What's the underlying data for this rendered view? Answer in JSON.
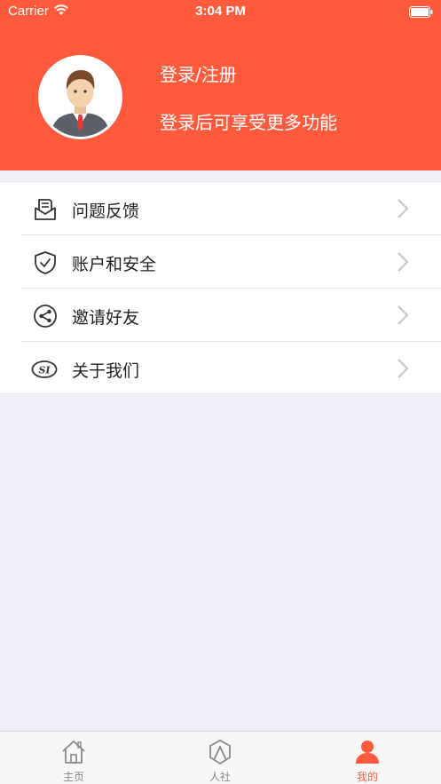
{
  "status_bar": {
    "carrier": "Carrier",
    "time": "3:04 PM"
  },
  "profile": {
    "title": "登录/注册",
    "subtitle": "登录后可享受更多功能"
  },
  "menu": {
    "items": [
      {
        "label": "问题反馈",
        "icon": "feedback-envelope-icon"
      },
      {
        "label": "账户和安全",
        "icon": "shield-check-icon"
      },
      {
        "label": "邀请好友",
        "icon": "share-icon"
      },
      {
        "label": "关于我们",
        "icon": "si-logo-icon"
      }
    ]
  },
  "tabbar": {
    "tabs": [
      {
        "label": "主页",
        "icon": "home-icon",
        "active": false
      },
      {
        "label": "人社",
        "icon": "people-shield-icon",
        "active": false
      },
      {
        "label": "我的",
        "icon": "person-icon",
        "active": true
      }
    ]
  },
  "colors": {
    "accent": "#ff5a3c",
    "background": "#efeff4",
    "tab_inactive": "#888888"
  }
}
